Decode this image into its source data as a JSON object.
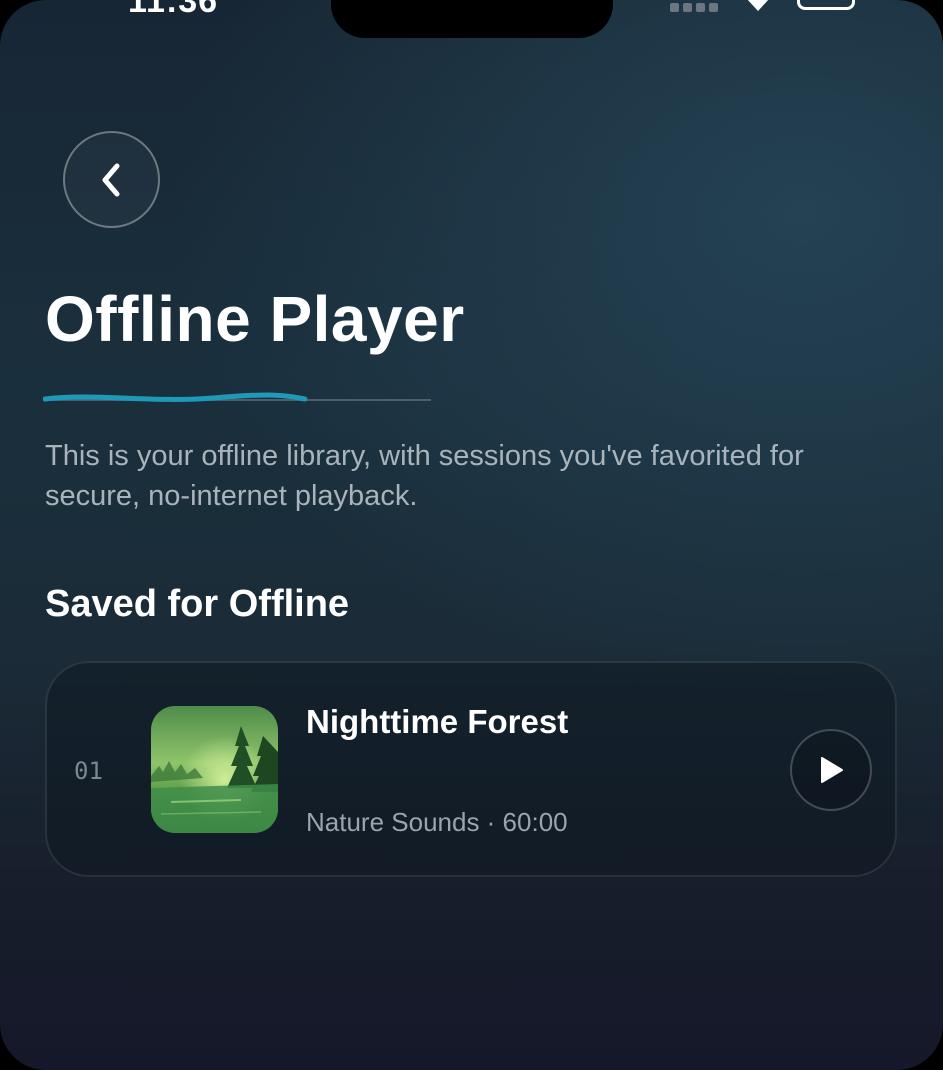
{
  "status_bar": {
    "time": "11:36"
  },
  "header": {
    "back_icon": "chevron-left-icon",
    "title": "Offline Player",
    "description": "This is your offline library, with sessions you've favorited for secure, no-internet playback."
  },
  "saved_section": {
    "title": "Saved for Offline",
    "tracks": [
      {
        "number": "01",
        "title": "Nighttime Forest",
        "meta": "Nature Sounds · 60:00",
        "artwork_icon": "forest-artwork",
        "action_icon": "play-icon"
      }
    ]
  },
  "colors": {
    "accent": "#1e9ab8",
    "background_top": "#172634",
    "background_bottom": "#15182a",
    "text_primary": "#ffffff",
    "text_secondary": "#a9b3bb"
  }
}
